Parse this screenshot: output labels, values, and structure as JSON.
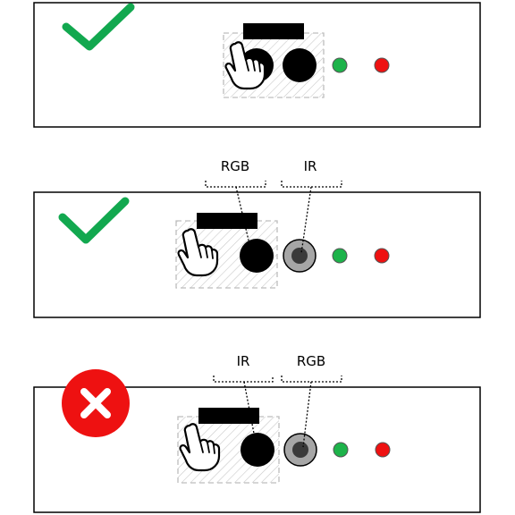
{
  "panels": [
    {
      "status": "correct",
      "status_icon": "check-icon",
      "labels": []
    },
    {
      "status": "correct",
      "status_icon": "check-icon",
      "labels": [
        "RGB",
        "IR"
      ]
    },
    {
      "status": "incorrect",
      "status_icon": "cross-icon",
      "labels": [
        "IR",
        "RGB"
      ]
    }
  ],
  "colors": {
    "check": "#12a84f",
    "cross": "#ee1111",
    "led_green": "#1db34a",
    "led_red": "#ee1111",
    "ir_sensor": "#a6a6a6",
    "outline": "#000000"
  }
}
